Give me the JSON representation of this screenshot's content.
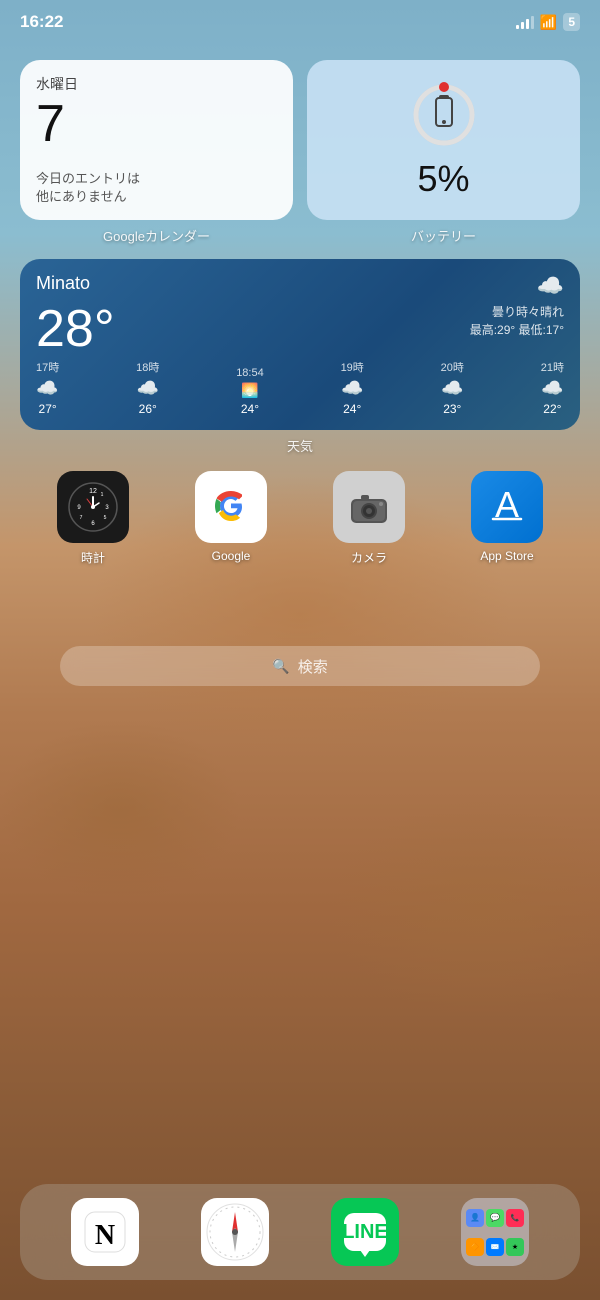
{
  "statusBar": {
    "time": "16:22",
    "battery": "5"
  },
  "widgets": {
    "calendar": {
      "dayLabel": "水曜日",
      "date": "7",
      "note": "今日のエントリは\n他にありません",
      "widgetLabel": "Googleカレンダー"
    },
    "battery": {
      "percent": "5%",
      "widgetLabel": "バッテリー"
    },
    "weather": {
      "city": "Minato",
      "temp": "28°",
      "description": "曇り時々晴れ",
      "high": "最高:29°",
      "low": "最低:17°",
      "widgetLabel": "天気",
      "hourly": [
        {
          "time": "17時",
          "icon": "☁️",
          "temp": "27°"
        },
        {
          "time": "18時",
          "icon": "☁️",
          "temp": "26°"
        },
        {
          "time": "18:54",
          "icon": "🌅",
          "temp": "24°"
        },
        {
          "time": "19時",
          "icon": "☁️",
          "temp": "24°"
        },
        {
          "time": "20時",
          "icon": "☁️",
          "temp": "23°"
        },
        {
          "time": "21時",
          "icon": "☁️",
          "temp": "22°"
        }
      ]
    }
  },
  "apps": {
    "clock": {
      "label": "時計"
    },
    "google": {
      "label": "Google"
    },
    "camera": {
      "label": "カメラ"
    },
    "appstore": {
      "label": "App Store"
    }
  },
  "searchBar": {
    "placeholder": "検索"
  },
  "dock": {
    "notion": {
      "label": "Notion"
    },
    "safari": {
      "label": "Safari"
    },
    "line": {
      "label": "LINE"
    },
    "folder": {
      "label": ""
    }
  }
}
